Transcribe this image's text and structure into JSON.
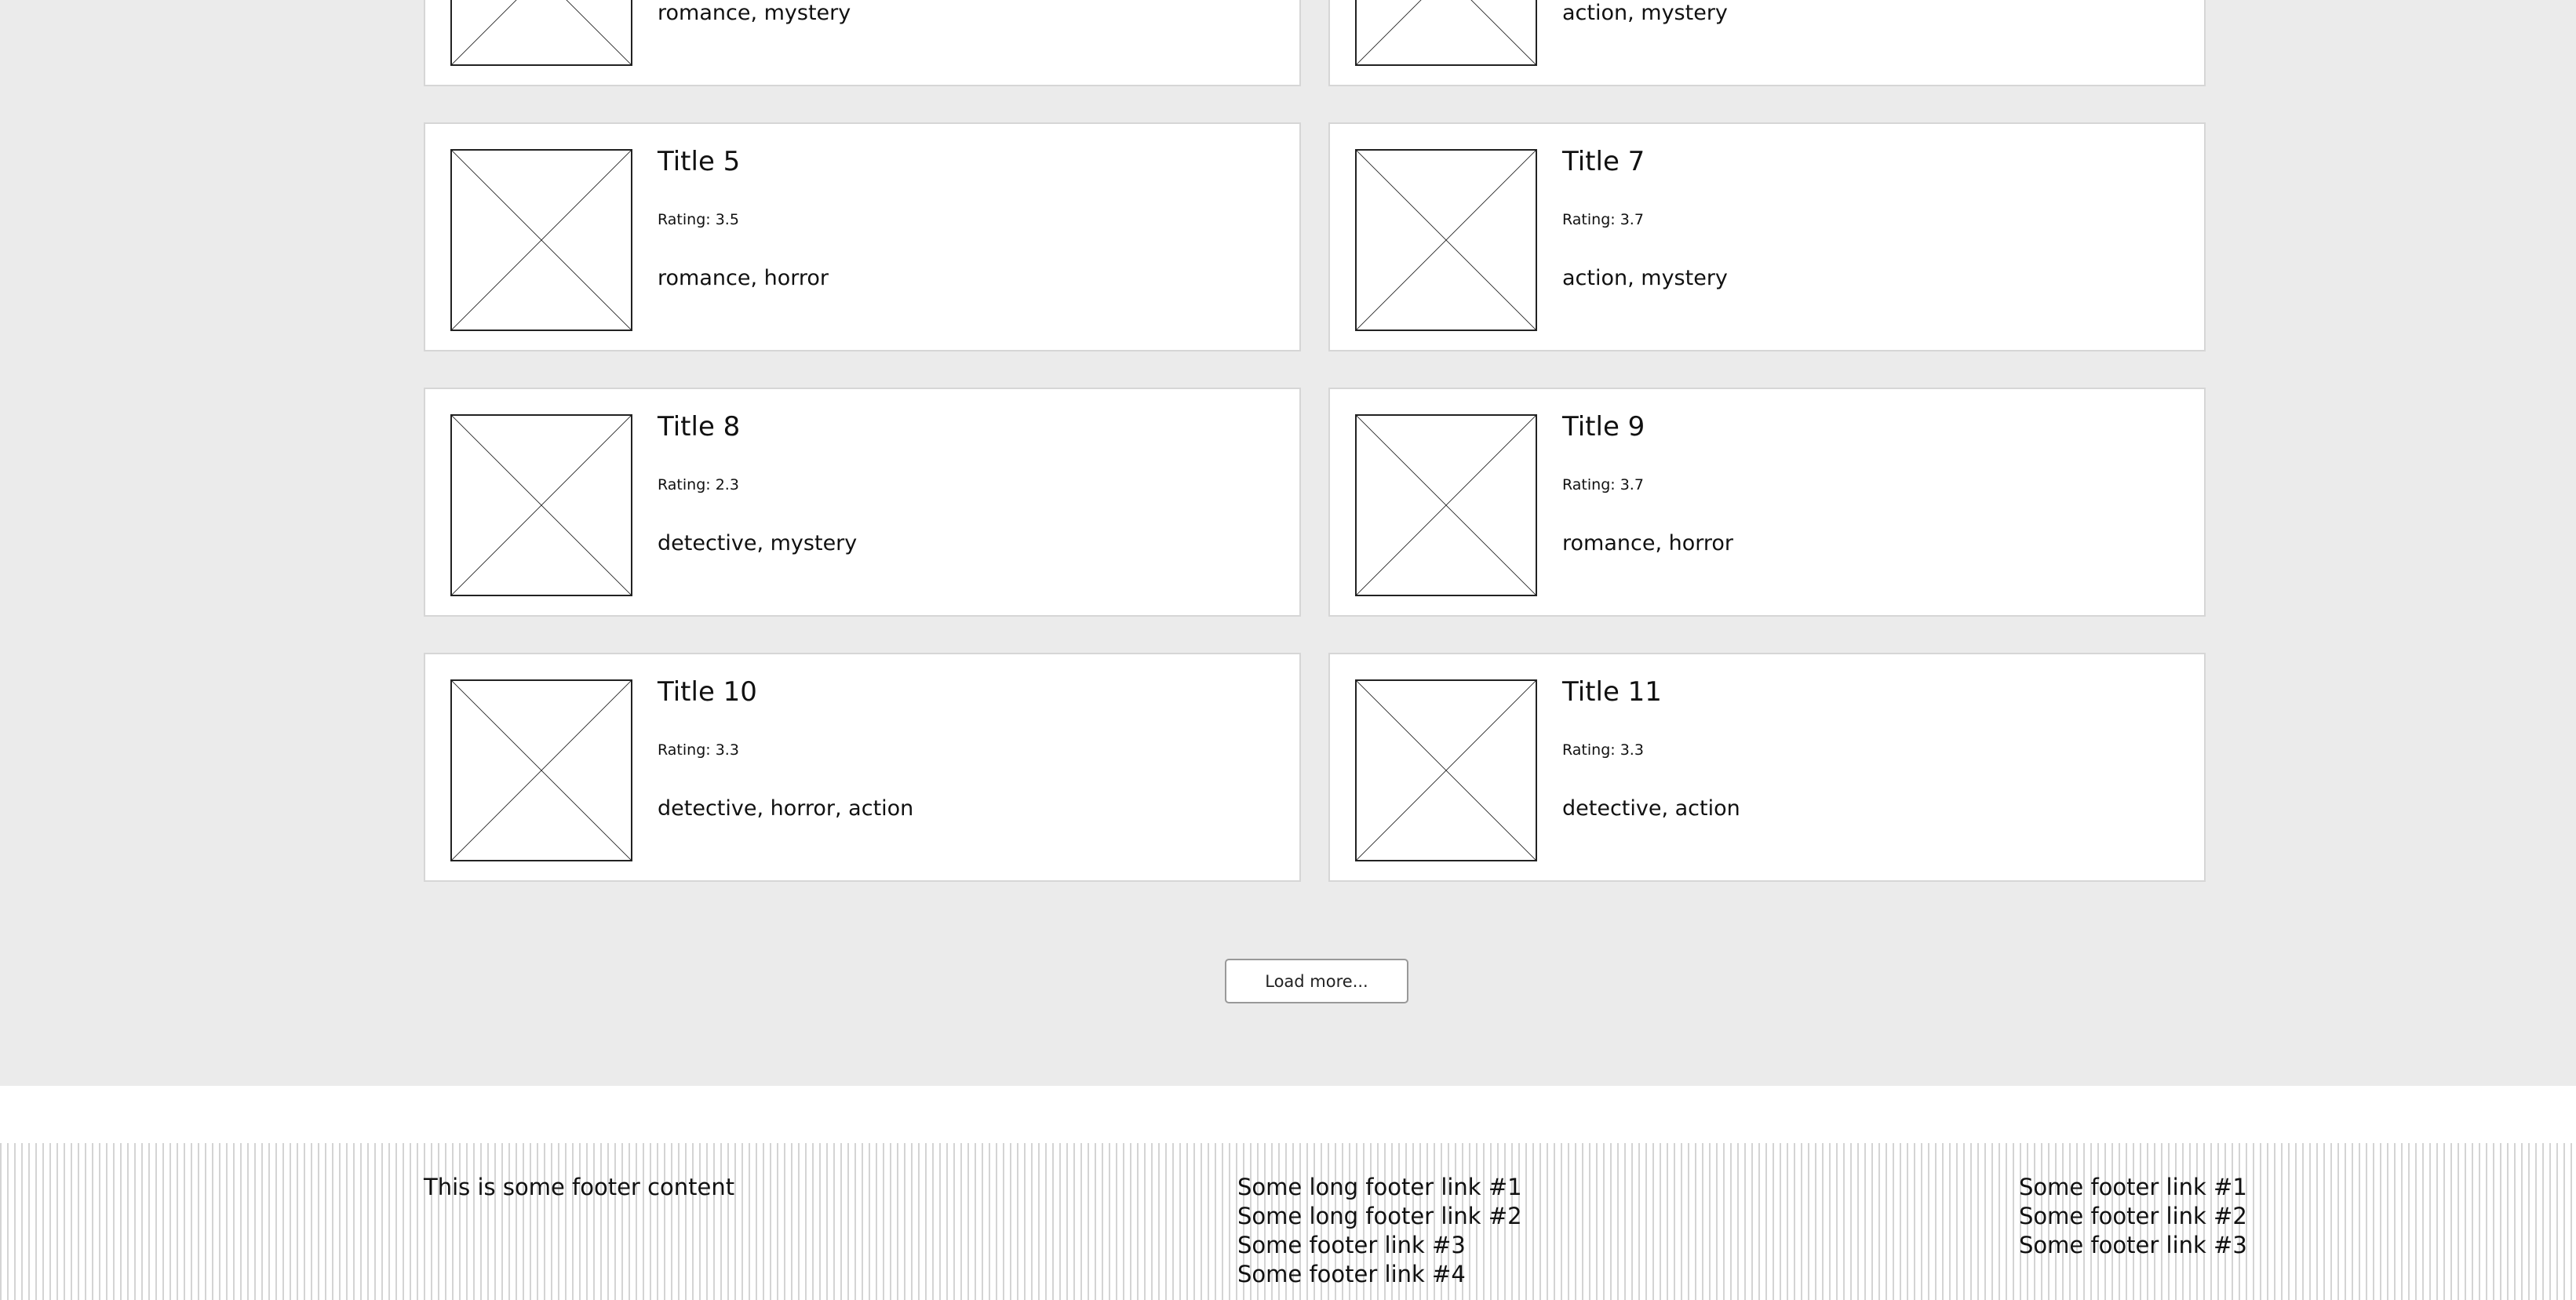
{
  "cards": [
    {
      "title": "",
      "rating": "",
      "genres": "romance, mystery"
    },
    {
      "title": "",
      "rating": "",
      "genres": "action, mystery"
    },
    {
      "title": "Title 5",
      "rating": "Rating: 3.5",
      "genres": "romance, horror"
    },
    {
      "title": "Title 7",
      "rating": "Rating: 3.7",
      "genres": "action, mystery"
    },
    {
      "title": "Title 8",
      "rating": "Rating: 2.3",
      "genres": "detective, mystery"
    },
    {
      "title": "Title 9",
      "rating": "Rating: 3.7",
      "genres": "romance, horror"
    },
    {
      "title": "Title 10",
      "rating": "Rating: 3.3",
      "genres": "detective, horror, action"
    },
    {
      "title": "Title 11",
      "rating": "Rating: 3.3",
      "genres": "detective, action"
    }
  ],
  "load_more": {
    "label": "Load more..."
  },
  "footer": {
    "content": "This is some footer content",
    "links_col1": [
      "Some long footer link #1",
      "Some long footer link #2",
      "Some footer link #3",
      "Some footer link #4"
    ],
    "links_col2": [
      "Some footer link #1",
      "Some footer link #2",
      "Some footer link #3"
    ]
  },
  "colors": {
    "page_background": "#ebebeb",
    "card_background": "#ffffff",
    "card_border": "#d6d6d6",
    "footer_stripe": "#d4d4d4"
  }
}
